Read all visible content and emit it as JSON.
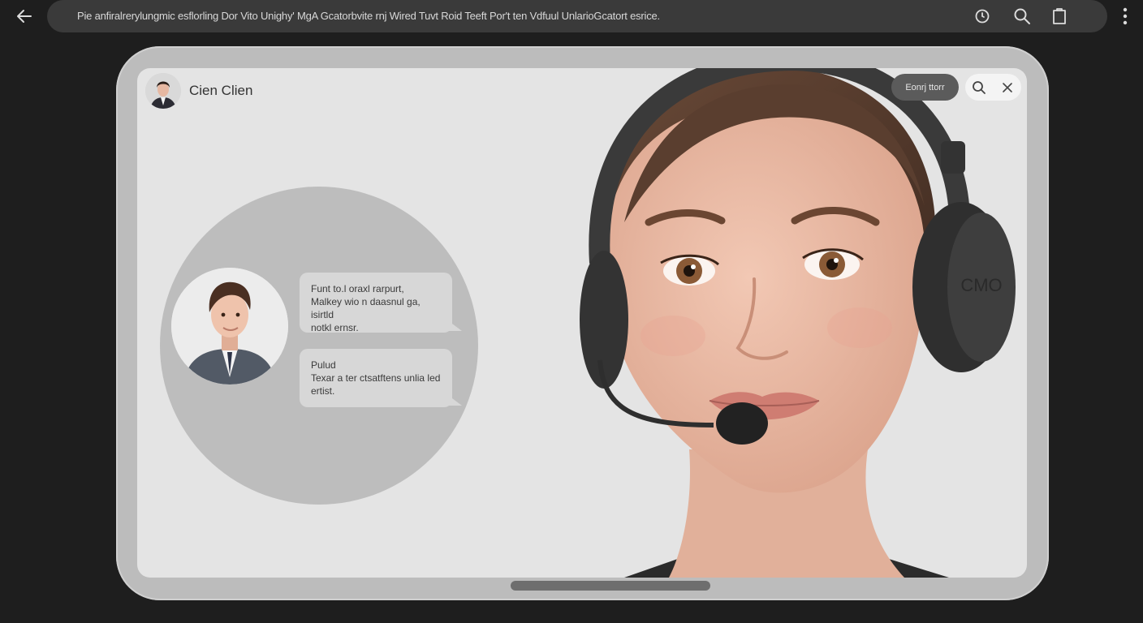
{
  "browser": {
    "url_text": "Pie anfiralrerylungmic esflorling Dor Vito Unighy' MgA Gcatorbvite rnj Wired Tuvt Roid Teeft Por't ten Vdfuul UnlarioGcatort esrice.",
    "icons": [
      "back-arrow-icon",
      "clock-icon",
      "search-icon",
      "bookmark-icon",
      "more-vert-icon"
    ]
  },
  "chat": {
    "contact_name": "Cien Clien",
    "action_button": "Eonrj ttorr",
    "bubbles": [
      {
        "lines": [
          "Funt to.l oraxl rarpurt,",
          "Malkey wio n daasnul ga, isirtld",
          "notkl ernsr."
        ]
      },
      {
        "lines": [
          "Pulud",
          "Texar a ter ctsatftens unlia  led",
          "ertist."
        ]
      }
    ]
  },
  "colors": {
    "background": "#1e1e1e",
    "bar": "#3a3a3a",
    "device": "#bcbcbc",
    "screen": "#e4e4e4",
    "circle": "#bdbdbd",
    "headset": "#3a3a3a"
  },
  "headset_label": "CMO"
}
